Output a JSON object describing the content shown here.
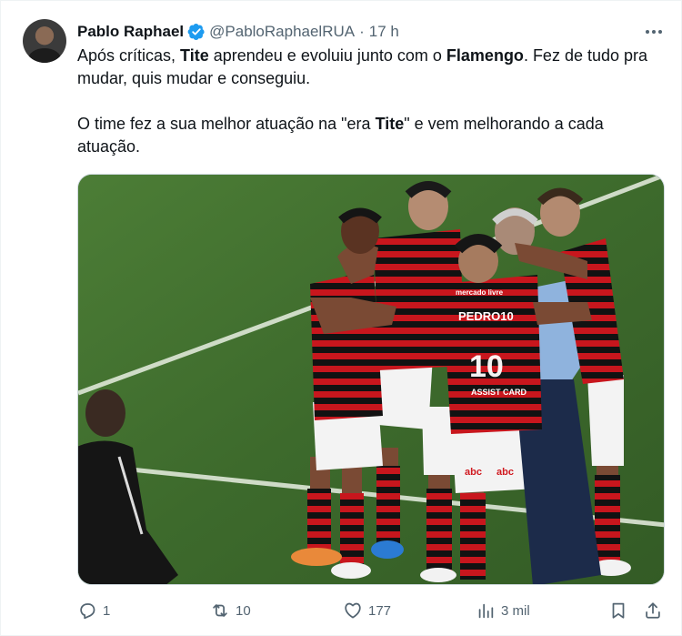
{
  "author": {
    "name": "Pablo Raphael",
    "handle": "@PabloRaphaelRUA",
    "separator": "·",
    "time": "17 h",
    "verified_color": "#1d9bf0"
  },
  "tweet": {
    "p1_a": "Após críticas, ",
    "p1_b": "Tite",
    "p1_c": " aprendeu e evoluiu junto com o ",
    "p1_d": "Flamengo",
    "p1_e": ". Fez de tudo pra mudar, quis mudar e conseguiu.",
    "p2_a": "O time fez a sua melhor atuação na \"era ",
    "p2_b": "Tite",
    "p2_c": "\" e vem melhorando a cada atuação."
  },
  "media": {
    "shirt_names": [
      "PEDRO10",
      "mercado livre",
      "abc",
      "abc",
      "ASSIST CARD"
    ]
  },
  "actions": {
    "replies": "1",
    "reposts": "10",
    "likes": "177",
    "views": "3 mil"
  },
  "icons": [
    "more-icon",
    "verified-icon",
    "reply-icon",
    "repost-icon",
    "like-icon",
    "views-icon",
    "bookmark-icon",
    "share-icon"
  ],
  "colors": {
    "text": "#0f1419",
    "secondary": "#536471",
    "flamengo_red": "#d01a20",
    "flamengo_black": "#111111"
  }
}
